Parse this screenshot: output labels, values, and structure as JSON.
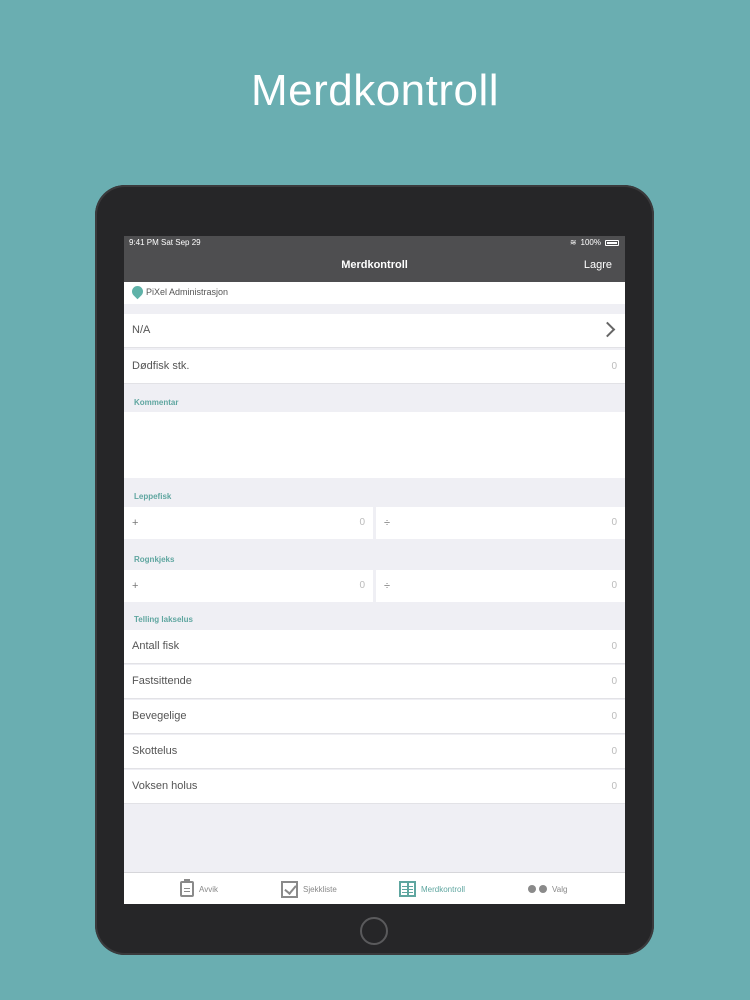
{
  "hero": {
    "title": "Merdkontroll"
  },
  "status_bar": {
    "time": "9:41 PM   Sat Sep 29",
    "battery": "100%"
  },
  "nav": {
    "title": "Merdkontroll",
    "save_label": "Lagre"
  },
  "location": {
    "label": "PiXel Administrasjon"
  },
  "selector": {
    "value": "N/A"
  },
  "dead_fish": {
    "label": "Dødfisk stk.",
    "value": "0"
  },
  "comment": {
    "header": "Kommentar",
    "value": ""
  },
  "leppefisk": {
    "header": "Leppefisk",
    "plus_sign": "+",
    "plus_value": "0",
    "minus_sign": "÷",
    "minus_value": "0"
  },
  "rognkjeks": {
    "header": "Rognkjeks",
    "plus_sign": "+",
    "plus_value": "0",
    "minus_sign": "÷",
    "minus_value": "0"
  },
  "lice": {
    "header": "Telling lakselus",
    "rows": [
      {
        "label": "Antall fisk",
        "value": "0"
      },
      {
        "label": "Fastsittende",
        "value": "0"
      },
      {
        "label": "Bevegelige",
        "value": "0"
      },
      {
        "label": "Skottelus",
        "value": "0"
      },
      {
        "label": "Voksen holus",
        "value": "0"
      }
    ]
  },
  "tabs": [
    {
      "label": "Avvik",
      "icon": "clipboard-icon"
    },
    {
      "label": "Sjekkliste",
      "icon": "checkbox-icon"
    },
    {
      "label": "Merdkontroll",
      "icon": "grid-list-icon",
      "active": true
    },
    {
      "label": "Valg",
      "icon": "dots-icon"
    }
  ],
  "colors": {
    "background": "#6aaeb1",
    "accent": "#5fa6a0",
    "navbar": "#4e4e50"
  }
}
